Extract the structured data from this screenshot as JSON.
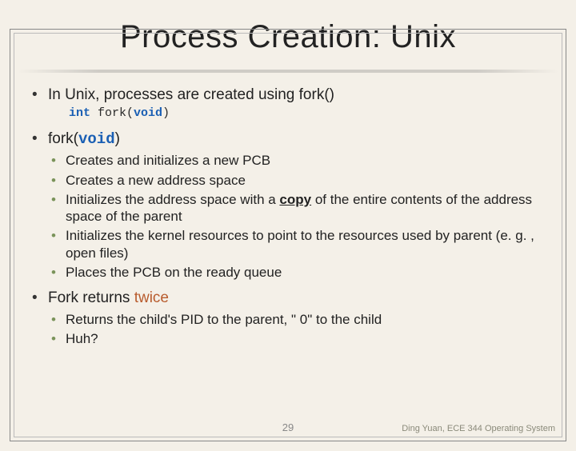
{
  "title": "Process Creation: Unix",
  "bullets": {
    "b1_text": "In Unix, processes are created using fork()",
    "b1_code_pre": "int",
    "b1_code_mid": " fork(",
    "b1_code_kw": "void",
    "b1_code_post": ")",
    "b2_pre": "fork(",
    "b2_kw": "void",
    "b2_post": ")",
    "b2_sub": {
      "s1": "Creates and initializes a new PCB",
      "s2": "Creates a new address space",
      "s3_pre": "Initializes the address space with a ",
      "s3_copy": "copy",
      "s3_post": " of the entire contents of the address space of the parent",
      "s4": "Initializes the kernel resources to point to the resources used by parent (e. g. , open files)",
      "s5": "Places the PCB on the ready queue"
    },
    "b3_pre": "Fork returns ",
    "b3_twice": "twice",
    "b3_sub": {
      "s1": "Returns the child's PID to the parent, \" 0\" to the child",
      "s2": "Huh?"
    }
  },
  "page_number": "29",
  "footer": "Ding Yuan, ECE 344 Operating System"
}
